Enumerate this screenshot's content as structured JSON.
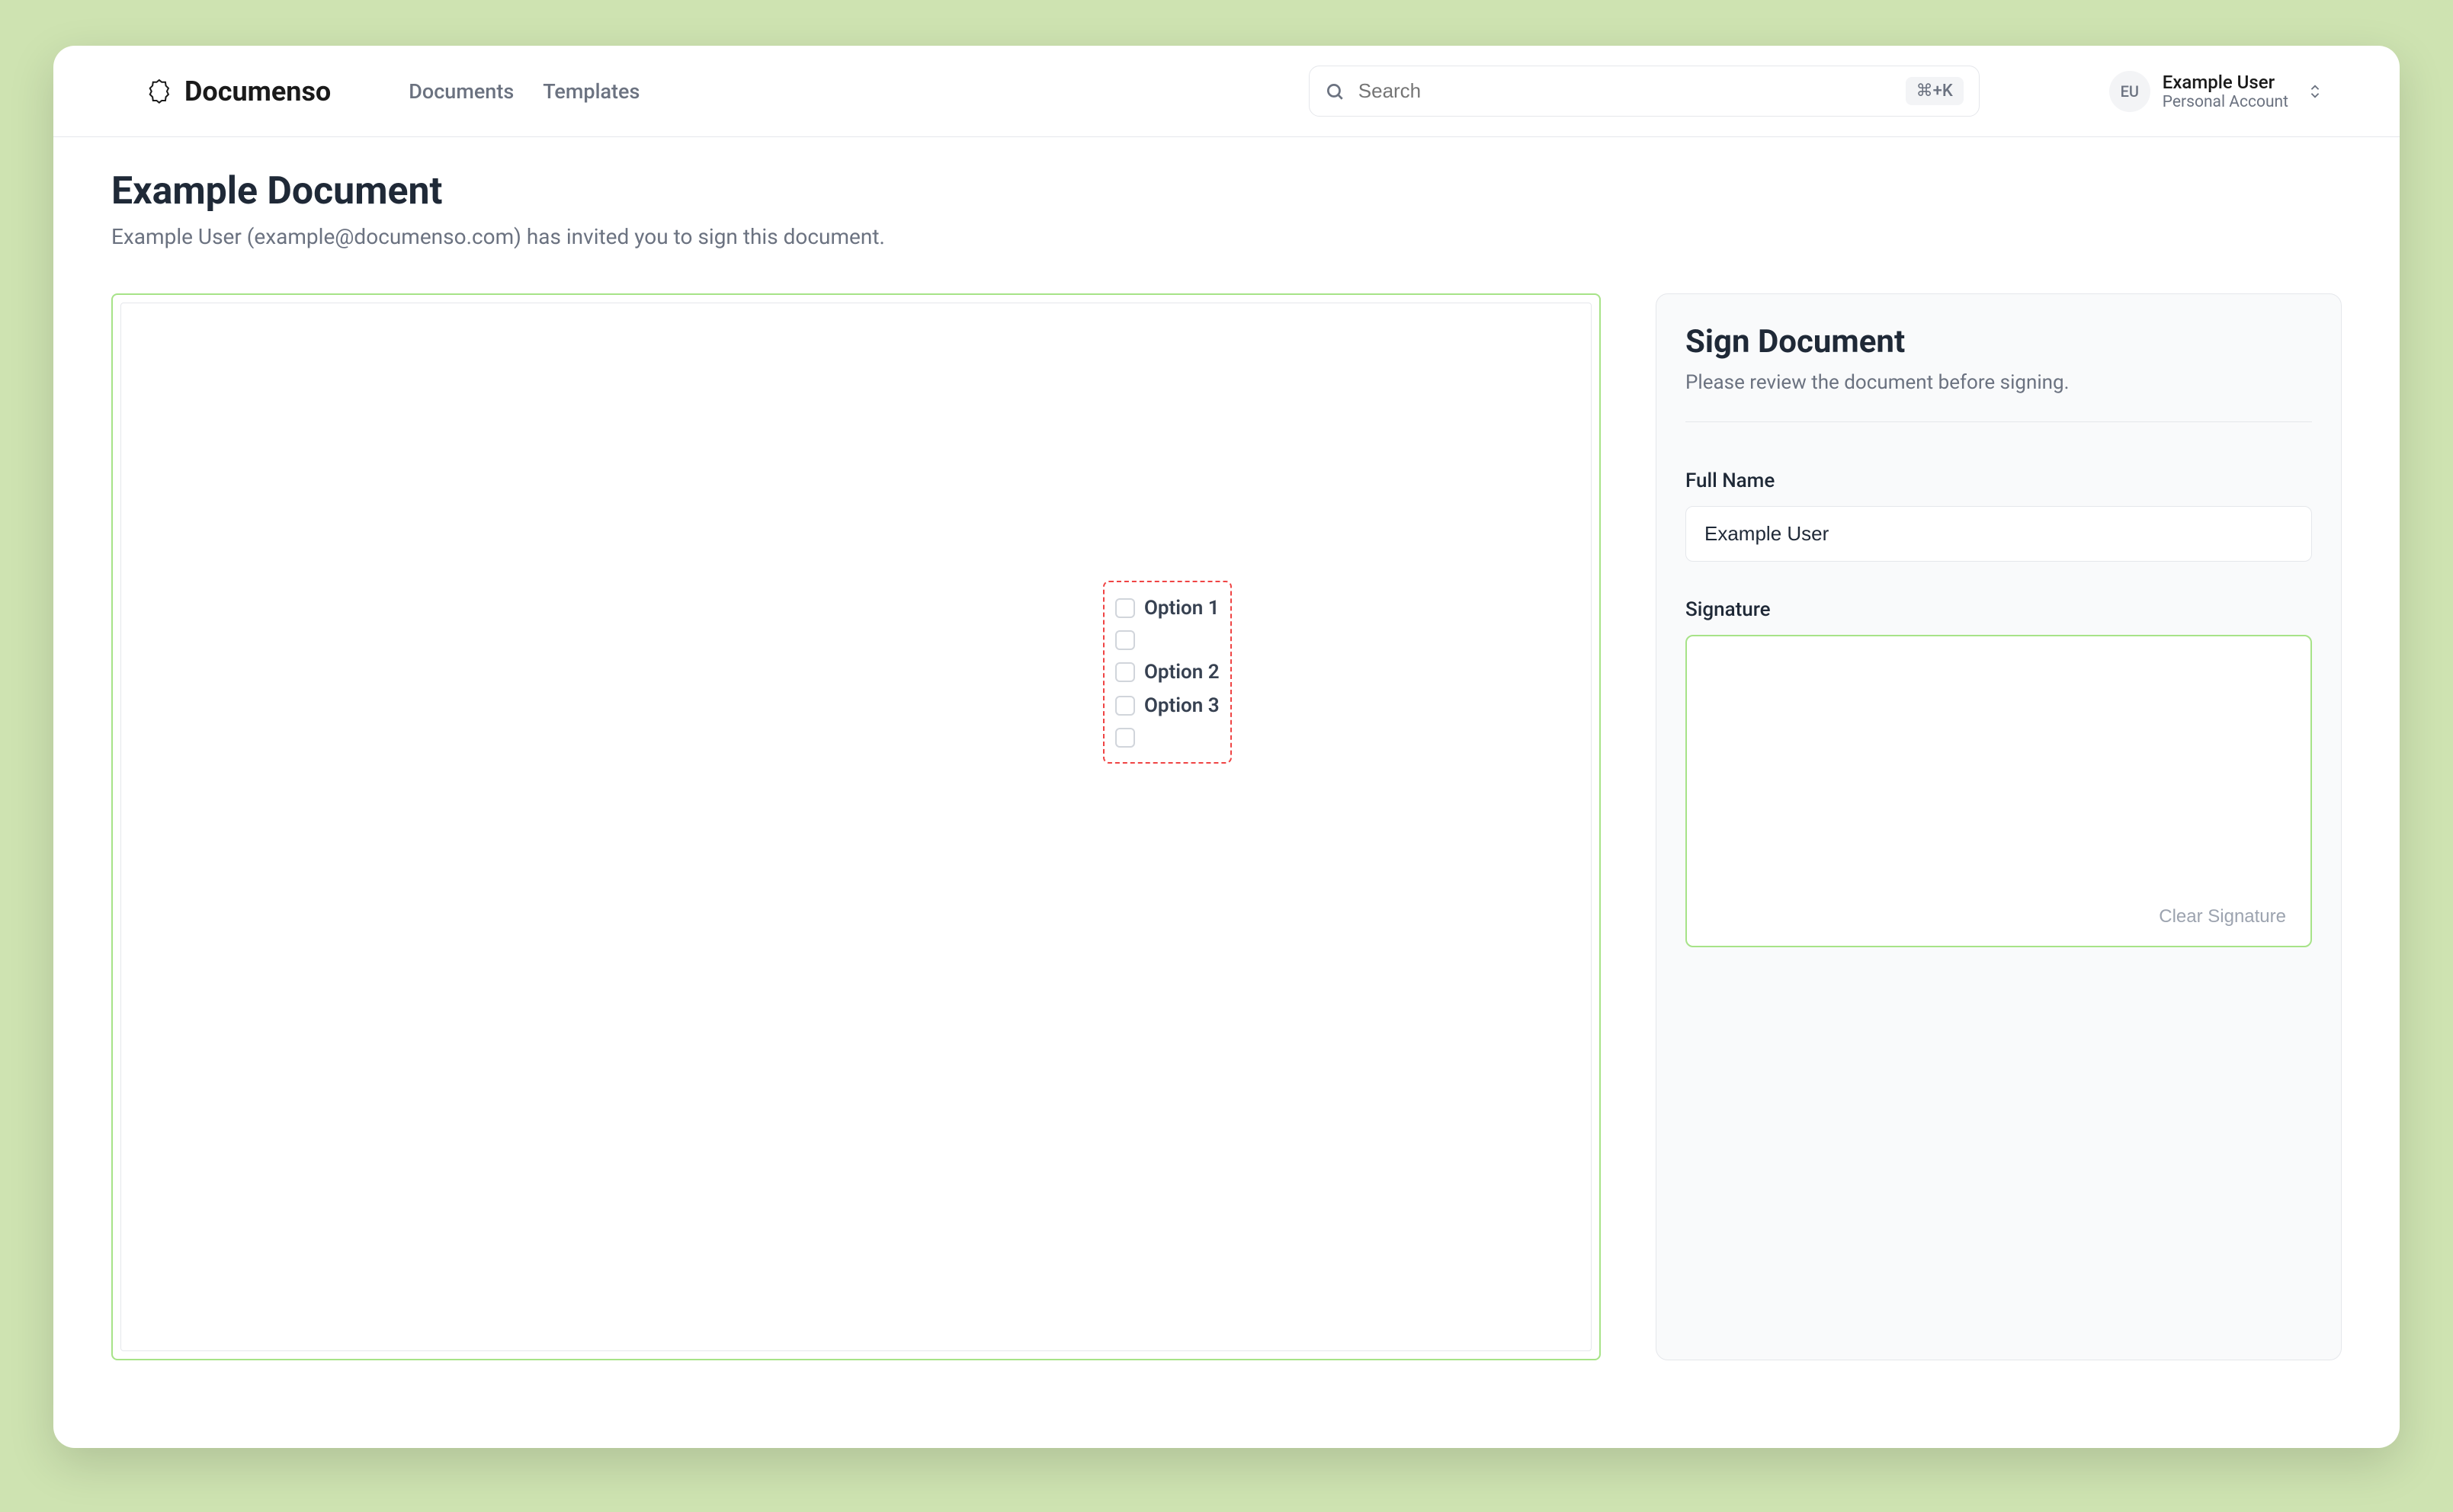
{
  "header": {
    "logo_text": "Documenso",
    "nav": {
      "documents": "Documents",
      "templates": "Templates"
    },
    "search": {
      "placeholder": "Search",
      "shortcut": "⌘+K"
    },
    "user": {
      "initials": "EU",
      "name": "Example User",
      "account": "Personal Account"
    }
  },
  "page": {
    "title": "Example Document",
    "subtitle": "Example User (example@documenso.com) has invited you to sign this document."
  },
  "document": {
    "checkbox_options": [
      "Option 1",
      "",
      "Option 2",
      "Option 3",
      ""
    ]
  },
  "sidebar": {
    "title": "Sign Document",
    "subtitle": "Please review the document before signing.",
    "full_name": {
      "label": "Full Name",
      "value": "Example User"
    },
    "signature": {
      "label": "Signature",
      "clear": "Clear Signature"
    }
  }
}
